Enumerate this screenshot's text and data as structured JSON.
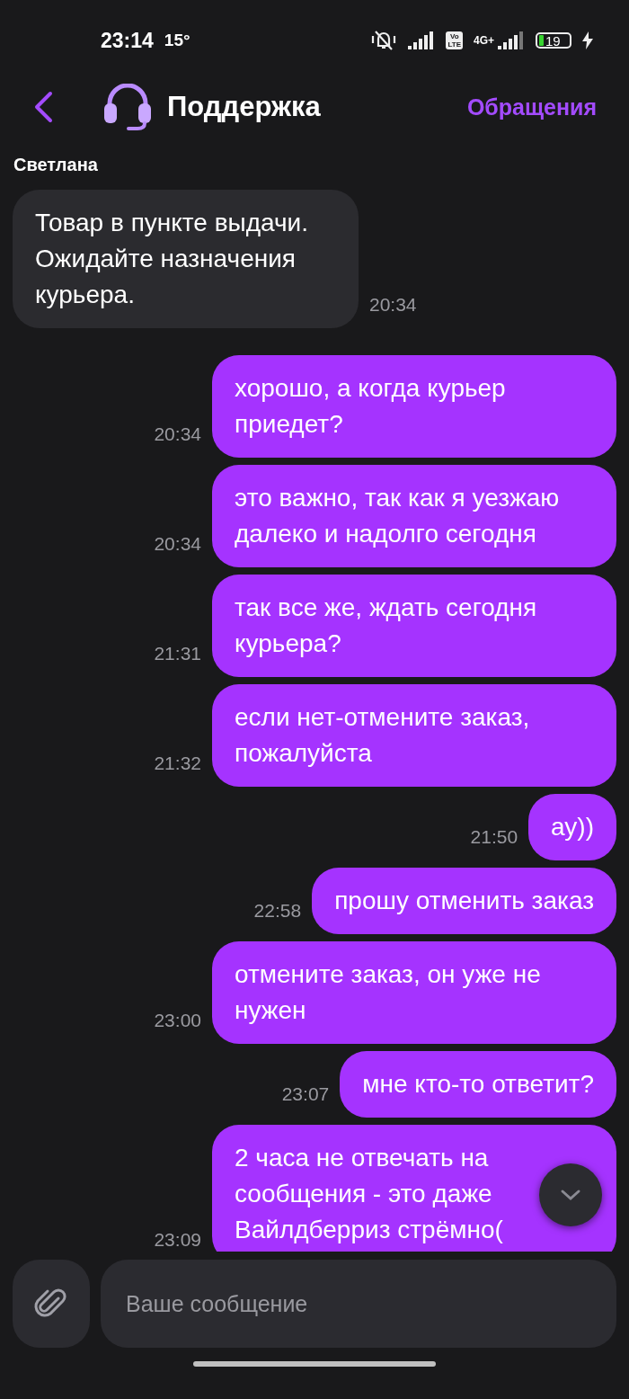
{
  "status_bar": {
    "time": "23:14",
    "temperature": "15°",
    "volte": [
      "Vo",
      "LTE"
    ],
    "network": "4G+",
    "battery": "19"
  },
  "header": {
    "title": "Поддержка",
    "action": "Обращения"
  },
  "messages": [
    {
      "kind": "incoming",
      "sender": "Светлана",
      "text": "Товар в пункте выдачи. Ожидайте назначения курьера.",
      "time": "20:34"
    },
    {
      "kind": "outgoing",
      "text": "хорошо, а когда курьер приедет?",
      "time": "20:34"
    },
    {
      "kind": "outgoing",
      "text": "это важно, так как я уезжаю далеко и надолго сегодня",
      "time": "20:34"
    },
    {
      "kind": "outgoing",
      "text": "так все же, ждать сегодня курьера?",
      "time": "21:31"
    },
    {
      "kind": "outgoing",
      "text": "если нет-отмените заказ, пожалуйста",
      "time": "21:32"
    },
    {
      "kind": "outgoing",
      "text": "ау))",
      "time": "21:50"
    },
    {
      "kind": "outgoing",
      "text": "прошу отменить заказ",
      "time": "22:58"
    },
    {
      "kind": "outgoing",
      "text": "отмените заказ, он уже не нужен",
      "time": "23:00"
    },
    {
      "kind": "outgoing",
      "text": "мне кто-то ответит?",
      "time": "23:07"
    },
    {
      "kind": "outgoing",
      "text": "2 часа не отвечать на сообщения - это даже Вайлдберриз стрёмно(",
      "time": "23:09"
    }
  ],
  "composer": {
    "placeholder": "Ваше сообщение"
  }
}
